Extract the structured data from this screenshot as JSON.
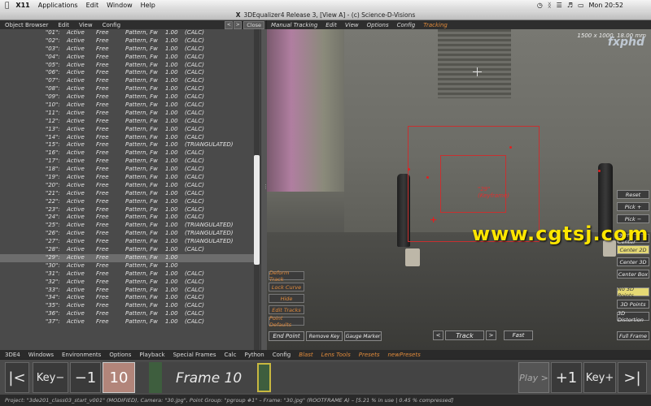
{
  "mac_menubar": {
    "apple_icon": "apple-icon",
    "items": [
      "X11",
      "Applications",
      "Edit",
      "Window",
      "Help"
    ],
    "clock": "Mon 20:52"
  },
  "window": {
    "title": "3DEqualizer4 Release 3, [View A]  -  (c) Science-D-Visions"
  },
  "object_browser": {
    "menu": [
      "Object Browser",
      "Edit",
      "View",
      "Config"
    ],
    "close_label": "Close",
    "points": [
      {
        "name": "\"01\":",
        "status": "Active",
        "free": "Free",
        "type": "Pattern, Fw",
        "val": "1.00",
        "calc": "(CALC)"
      },
      {
        "name": "\"02\":",
        "status": "Active",
        "free": "Free",
        "type": "Pattern, Fw",
        "val": "1.00",
        "calc": "(CALC)"
      },
      {
        "name": "\"03\":",
        "status": "Active",
        "free": "Free",
        "type": "Pattern, Fw",
        "val": "1.00",
        "calc": "(CALC)"
      },
      {
        "name": "\"04\":",
        "status": "Active",
        "free": "Free",
        "type": "Pattern, Fw",
        "val": "1.00",
        "calc": "(CALC)"
      },
      {
        "name": "\"05\":",
        "status": "Active",
        "free": "Free",
        "type": "Pattern, Fw",
        "val": "1.00",
        "calc": "(CALC)"
      },
      {
        "name": "\"06\":",
        "status": "Active",
        "free": "Free",
        "type": "Pattern, Fw",
        "val": "1.00",
        "calc": "(CALC)"
      },
      {
        "name": "\"07\":",
        "status": "Active",
        "free": "Free",
        "type": "Pattern, Fw",
        "val": "1.00",
        "calc": "(CALC)"
      },
      {
        "name": "\"08\":",
        "status": "Active",
        "free": "Free",
        "type": "Pattern, Fw",
        "val": "1.00",
        "calc": "(CALC)"
      },
      {
        "name": "\"09\":",
        "status": "Active",
        "free": "Free",
        "type": "Pattern, Fw",
        "val": "1.00",
        "calc": "(CALC)"
      },
      {
        "name": "\"10\":",
        "status": "Active",
        "free": "Free",
        "type": "Pattern, Fw",
        "val": "1.00",
        "calc": "(CALC)"
      },
      {
        "name": "\"11\":",
        "status": "Active",
        "free": "Free",
        "type": "Pattern, Fw",
        "val": "1.00",
        "calc": "(CALC)"
      },
      {
        "name": "\"12\":",
        "status": "Active",
        "free": "Free",
        "type": "Pattern, Fw",
        "val": "1.00",
        "calc": "(CALC)"
      },
      {
        "name": "\"13\":",
        "status": "Active",
        "free": "Free",
        "type": "Pattern, Fw",
        "val": "1.00",
        "calc": "(CALC)"
      },
      {
        "name": "\"14\":",
        "status": "Active",
        "free": "Free",
        "type": "Pattern, Fw",
        "val": "1.00",
        "calc": "(CALC)"
      },
      {
        "name": "\"15\":",
        "status": "Active",
        "free": "Free",
        "type": "Pattern, Fw",
        "val": "1.00",
        "calc": "(TRIANGULATED)"
      },
      {
        "name": "\"16\":",
        "status": "Active",
        "free": "Free",
        "type": "Pattern, Fw",
        "val": "1.00",
        "calc": "(CALC)"
      },
      {
        "name": "\"17\":",
        "status": "Active",
        "free": "Free",
        "type": "Pattern, Fw",
        "val": "1.00",
        "calc": "(CALC)"
      },
      {
        "name": "\"18\":",
        "status": "Active",
        "free": "Free",
        "type": "Pattern, Fw",
        "val": "1.00",
        "calc": "(CALC)"
      },
      {
        "name": "\"19\":",
        "status": "Active",
        "free": "Free",
        "type": "Pattern, Fw",
        "val": "1.00",
        "calc": "(CALC)"
      },
      {
        "name": "\"20\":",
        "status": "Active",
        "free": "Free",
        "type": "Pattern, Fw",
        "val": "1.00",
        "calc": "(CALC)"
      },
      {
        "name": "\"21\":",
        "status": "Active",
        "free": "Free",
        "type": "Pattern, Fw",
        "val": "1.00",
        "calc": "(CALC)"
      },
      {
        "name": "\"22\":",
        "status": "Active",
        "free": "Free",
        "type": "Pattern, Fw",
        "val": "1.00",
        "calc": "(CALC)"
      },
      {
        "name": "\"23\":",
        "status": "Active",
        "free": "Free",
        "type": "Pattern, Fw",
        "val": "1.00",
        "calc": "(CALC)"
      },
      {
        "name": "\"24\":",
        "status": "Active",
        "free": "Free",
        "type": "Pattern, Fw",
        "val": "1.00",
        "calc": "(CALC)"
      },
      {
        "name": "\"25\":",
        "status": "Active",
        "free": "Free",
        "type": "Pattern, Fw",
        "val": "1.00",
        "calc": "(TRIANGULATED)"
      },
      {
        "name": "\"26\":",
        "status": "Active",
        "free": "Free",
        "type": "Pattern, Fw",
        "val": "1.00",
        "calc": "(TRIANGULATED)"
      },
      {
        "name": "\"27\":",
        "status": "Active",
        "free": "Free",
        "type": "Pattern, Fw",
        "val": "1.00",
        "calc": "(TRIANGULATED)"
      },
      {
        "name": "\"28\":",
        "status": "Active",
        "free": "Free",
        "type": "Pattern, Fw",
        "val": "1.00",
        "calc": "(CALC)"
      },
      {
        "name": "\"29\":",
        "status": "Active",
        "free": "Free",
        "type": "Pattern, Fw",
        "val": "1.00",
        "calc": "",
        "selected": true
      },
      {
        "name": "\"30\":",
        "status": "Active",
        "free": "Free",
        "type": "Pattern, Fw",
        "val": "1.00",
        "calc": ""
      },
      {
        "name": "\"31\":",
        "status": "Active",
        "free": "Free",
        "type": "Pattern, Fw",
        "val": "1.00",
        "calc": "(CALC)"
      },
      {
        "name": "\"32\":",
        "status": "Active",
        "free": "Free",
        "type": "Pattern, Fw",
        "val": "1.00",
        "calc": "(CALC)"
      },
      {
        "name": "\"33\":",
        "status": "Active",
        "free": "Free",
        "type": "Pattern, Fw",
        "val": "1.00",
        "calc": "(CALC)"
      },
      {
        "name": "\"34\":",
        "status": "Active",
        "free": "Free",
        "type": "Pattern, Fw",
        "val": "1.00",
        "calc": "(CALC)"
      },
      {
        "name": "\"35\":",
        "status": "Active",
        "free": "Free",
        "type": "Pattern, Fw",
        "val": "1.00",
        "calc": "(CALC)"
      },
      {
        "name": "\"36\":",
        "status": "Active",
        "free": "Free",
        "type": "Pattern, Fw",
        "val": "1.00",
        "calc": "(CALC)"
      },
      {
        "name": "\"37\":",
        "status": "Active",
        "free": "Free",
        "type": "Pattern, Fw",
        "val": "1.00",
        "calc": "(CALC)"
      }
    ]
  },
  "tracking_view": {
    "menu": [
      "Manual Tracking",
      "Edit",
      "View",
      "Options",
      "Config"
    ],
    "active_menu": "Tracking",
    "resolution": "1500 x 1000, 18.00 mm",
    "point_label_line1": "\"29\"",
    "point_label_line2": "(Keyframe)",
    "watermark": "www.cgtsj.com",
    "logo": "fxphd",
    "left_buttons": [
      "Deform Track",
      "Lock Curve",
      "Hide",
      "Edit Tracks",
      "Point Defaults"
    ],
    "bottom_buttons": {
      "end_point": "End Point",
      "remove_key": "Remove Key",
      "gauge_marker": "Gauge Marker",
      "track": "Track",
      "fast": "Fast"
    },
    "side_buttons": [
      {
        "label": "Reset",
        "hl": false
      },
      {
        "label": "Pick +",
        "hl": false
      },
      {
        "label": "Pick −",
        "hl": false
      },
      {
        "label": "Don't Center",
        "hl": false
      },
      {
        "label": "Center 2D",
        "hl": true
      },
      {
        "label": "Center 3D",
        "hl": false
      },
      {
        "label": "Center Box",
        "hl": false
      },
      {
        "label": "No 3D Points",
        "hl": true
      },
      {
        "label": "3D Points",
        "hl": false
      },
      {
        "label": "3D Distortion",
        "hl": false
      },
      {
        "label": "Full Frame",
        "hl": false
      }
    ]
  },
  "lower_menu": {
    "items": [
      "3DE4",
      "Windows",
      "Environments",
      "Options",
      "Playback",
      "Special Frames",
      "Calc",
      "Python",
      "Config"
    ],
    "orange_items": [
      "Blast",
      "Lens Tools",
      "Presets",
      "newPresets"
    ]
  },
  "timeline": {
    "first": "|<",
    "key_minus": "Key−",
    "minus_one": "−1",
    "frame_box": "10",
    "frame_label": "Frame 10",
    "play": "Play >",
    "plus_one": "+1",
    "key_plus": "Key+",
    "last": ">|"
  },
  "status": "Project: \"3de201_class03_start_v001\" (MODIFIED), Camera: \"30.jpg\", Point Group: \"pgroup #1\"  –  Frame: \"30.jpg\" (ROOTFRAME A)  –  [5.21 % in use | 0.45 % compressed]"
}
